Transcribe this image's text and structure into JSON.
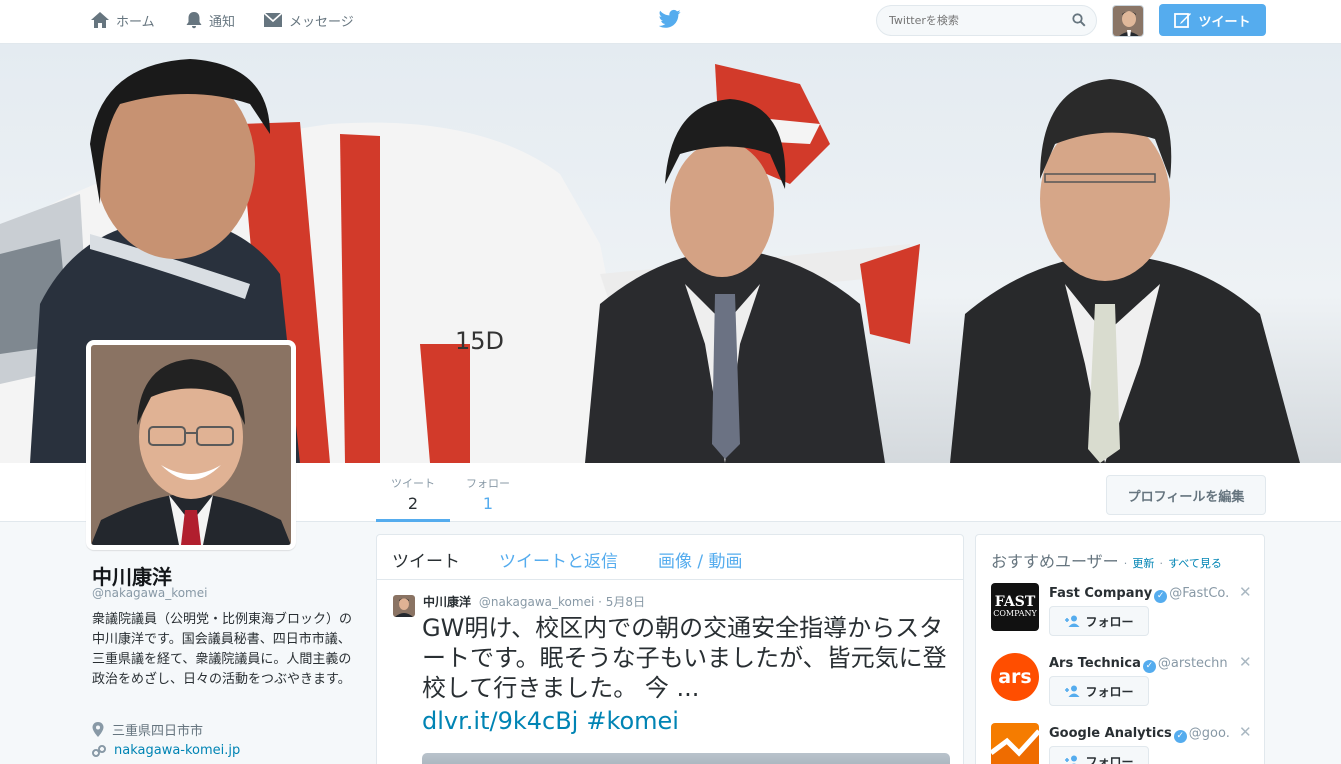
{
  "nav": {
    "home": "ホーム",
    "notifications": "通知",
    "messages": "メッセージ",
    "search_placeholder": "Twitterを検索",
    "tweet_button": "ツイート"
  },
  "profile_nav": {
    "tweets_label": "ツイート",
    "tweets_count": "2",
    "following_label": "フォロー",
    "following_count": "1",
    "edit_profile": "プロフィールを編集"
  },
  "profile": {
    "name": "中川康洋",
    "handle": "@nakagawa_komei",
    "bio": "衆議院議員（公明党・比例東海ブロック）の中川康洋です。国会議員秘書、四日市市議、三重県議を経て、衆議院議員に。人間主義の政治をめざし、日々の活動をつぶやきます。",
    "location": "三重県四日市市",
    "url": "nakagawa-komei.jp"
  },
  "timeline": {
    "tabs": [
      "ツイート",
      "ツイートと返信",
      "画像 / 動画"
    ],
    "tweet": {
      "name": "中川康洋",
      "handle": "@nakagawa_komei",
      "separator": "·",
      "date": "5月8日",
      "text": "GW明け、校区内での朝の交通安全指導からスタートです。眠そうな子もいましたが、皆元気に登校して行きました。 今 ...",
      "link": "dlvr.it/9k4cBj",
      "hashtag": "#komei"
    }
  },
  "recommendations": {
    "title": "おすすめユーザー",
    "separator1": "·",
    "refresh": "更新",
    "separator2": "·",
    "view_all": "すべて見る",
    "follow_label": "フォロー",
    "users": [
      {
        "name": "Fast Company",
        "handle": "@FastCo...",
        "logo_line1": "FAST",
        "logo_line2": "COMPANY"
      },
      {
        "name": "Ars Technica",
        "handle": "@arstechn...",
        "logo": "ars"
      },
      {
        "name": "Google Analytics",
        "handle": "@goo..."
      }
    ]
  },
  "colors": {
    "accent": "#55acee",
    "link": "#0084b4",
    "ars": "#ff4e00",
    "analytics": "#f57c00"
  }
}
